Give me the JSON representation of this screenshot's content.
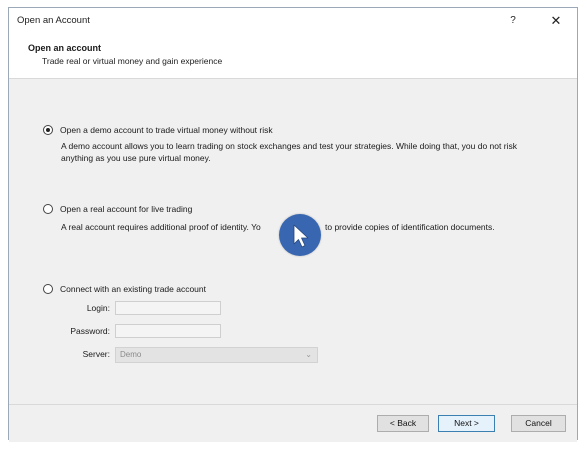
{
  "window": {
    "title": "Open an Account",
    "help_label": "?",
    "close_label": "✕"
  },
  "header": {
    "title": "Open an account",
    "subtitle": "Trade real or virtual money and gain experience"
  },
  "options": [
    {
      "label": "Open a demo account to trade virtual money without risk",
      "selected": true,
      "description": "A demo account allows you to learn trading on stock exchanges and test your strategies. While doing that, you do not risk anything as you use pure virtual money."
    },
    {
      "label": "Open a real account for live trading",
      "selected": false,
      "description_left": "A real account requires additional proof of identity. Yo",
      "description_right": "to provide copies of identification documents."
    },
    {
      "label": "Connect with an existing trade account",
      "selected": false
    }
  ],
  "fields": {
    "login_label": "Login:",
    "login_value": "",
    "password_label": "Password:",
    "password_value": "",
    "server_label": "Server:",
    "server_value": "Demo"
  },
  "buttons": {
    "back": "< Back",
    "next": "Next >",
    "cancel": "Cancel"
  },
  "icons": {
    "cursor": "mouse-pointer-icon",
    "dropdown": "chevron-down-icon"
  },
  "colors": {
    "cursor_badge": "#2f5fad",
    "primary_button_border": "#3c7fb1"
  }
}
